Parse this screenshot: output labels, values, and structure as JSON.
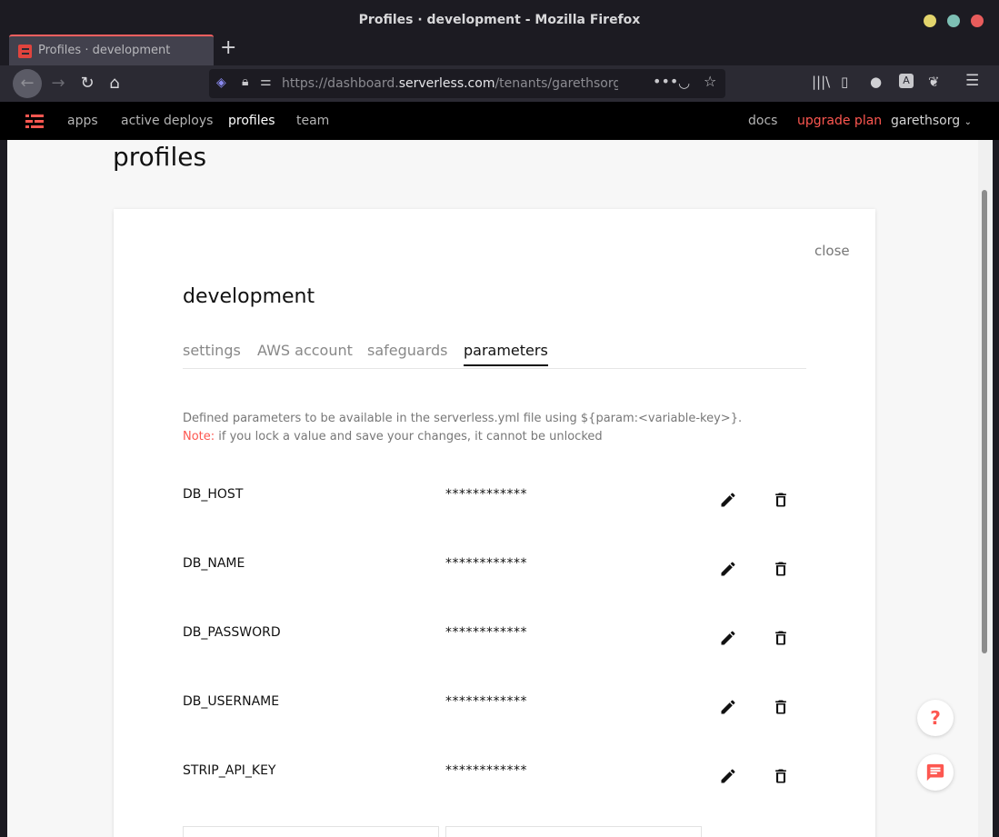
{
  "window": {
    "title": "Profiles · development - Mozilla Firefox"
  },
  "browser": {
    "tab_title": "Profiles · development",
    "new_tab": "+",
    "url_prefix": "https://dashboard.",
    "url_domain": "serverless.com",
    "url_path": "/tenants/garethsorg/deployment-profiles/development"
  },
  "appnav": {
    "items": [
      {
        "label": "apps"
      },
      {
        "label": "active deploys"
      },
      {
        "label": "profiles"
      },
      {
        "label": "team"
      }
    ],
    "docs": "docs",
    "upgrade": "upgrade plan",
    "user": "garethsorg",
    "active_index": 2
  },
  "page": {
    "title": "profiles"
  },
  "card": {
    "close": "close",
    "title": "development",
    "tabs": [
      {
        "label": "settings"
      },
      {
        "label": "AWS account"
      },
      {
        "label": "safeguards"
      },
      {
        "label": "parameters"
      }
    ],
    "active_tab": "parameters",
    "description": "Defined parameters to be available in the serverless.yml file using ${param:<variable-key>}.",
    "note_label": "Note:",
    "note_text": " if you lock a value and save your changes, it cannot be unlocked"
  },
  "parameters": [
    {
      "key": "DB_HOST",
      "value": "************"
    },
    {
      "key": "DB_NAME",
      "value": "************"
    },
    {
      "key": "DB_PASSWORD",
      "value": "************"
    },
    {
      "key": "DB_USERNAME",
      "value": "************"
    },
    {
      "key": "STRIP_API_KEY",
      "value": "************"
    }
  ],
  "fab": {
    "help": "?"
  },
  "colors": {
    "accent": "#fd5750",
    "nav_bg": "#000000",
    "page_bg": "#f7f7f7"
  }
}
